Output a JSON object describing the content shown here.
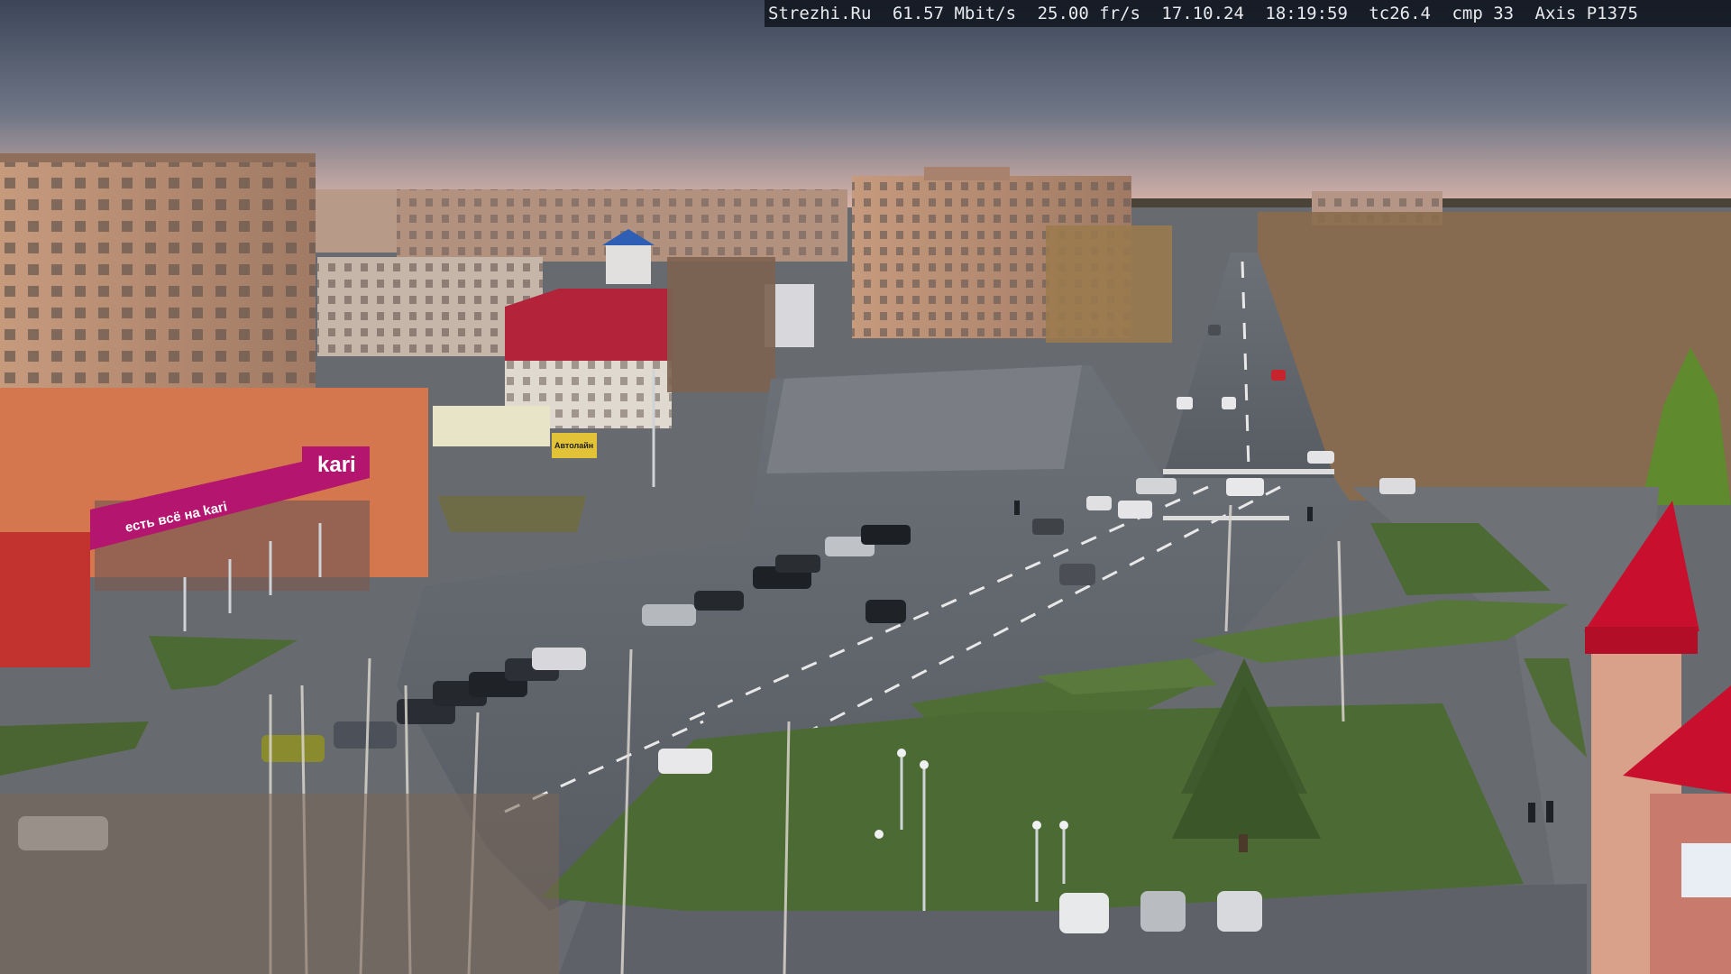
{
  "overlay": {
    "site": "Strezhi.Ru",
    "bitrate": "61.57 Mbit/s",
    "framerate": "25.00 fr/s",
    "date": "17.10.24",
    "time": "18:19:59",
    "tc": "tc26.4",
    "cmp": "cmp 33",
    "camera": "Axis P1375"
  },
  "signs": {
    "store_brand": "kari",
    "store_tagline": "есть всё на kari",
    "small_sign": "Автолайн"
  },
  "colors": {
    "sky_top": "#3f4a5c",
    "sky_bottom": "#d8b3a8",
    "kari_magenta": "#b4156e",
    "roof_red": "#c8102e"
  }
}
